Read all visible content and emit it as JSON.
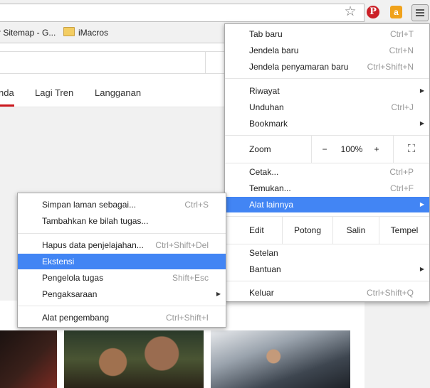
{
  "bookmarks_bar": {
    "items": [
      "r Sitemap - G...",
      "iMacros"
    ]
  },
  "youtube_tabs": [
    "nda",
    "Lagi Tren",
    "Langganan"
  ],
  "chrome_menu": {
    "tab_baru": {
      "label": "Tab baru",
      "shortcut": "Ctrl+T"
    },
    "jendela_baru": {
      "label": "Jendela baru",
      "shortcut": "Ctrl+N"
    },
    "jendela_penyamaran": {
      "label": "Jendela penyamaran baru",
      "shortcut": "Ctrl+Shift+N"
    },
    "riwayat": {
      "label": "Riwayat"
    },
    "unduhan": {
      "label": "Unduhan",
      "shortcut": "Ctrl+J"
    },
    "bookmark": {
      "label": "Bookmark"
    },
    "zoom": {
      "label": "Zoom",
      "minus": "−",
      "value": "100%",
      "plus": "+"
    },
    "cetak": {
      "label": "Cetak...",
      "shortcut": "Ctrl+P"
    },
    "temukan": {
      "label": "Temukan...",
      "shortcut": "Ctrl+F"
    },
    "alat_lainnya": {
      "label": "Alat lainnya"
    },
    "edit": {
      "label": "Edit",
      "potong": "Potong",
      "salin": "Salin",
      "tempel": "Tempel"
    },
    "setelan": {
      "label": "Setelan"
    },
    "bantuan": {
      "label": "Bantuan"
    },
    "keluar": {
      "label": "Keluar",
      "shortcut": "Ctrl+Shift+Q"
    }
  },
  "submenu": {
    "simpan": {
      "label": "Simpan laman sebagai...",
      "shortcut": "Ctrl+S"
    },
    "tambahkan": {
      "label": "Tambahkan ke bilah tugas..."
    },
    "hapus": {
      "label": "Hapus data penjelajahan...",
      "shortcut": "Ctrl+Shift+Del"
    },
    "ekstensi": {
      "label": "Ekstensi"
    },
    "pengelola": {
      "label": "Pengelola tugas",
      "shortcut": "Shift+Esc"
    },
    "pengaksaraan": {
      "label": "Pengaksaraan"
    },
    "alat_pengembang": {
      "label": "Alat pengembang",
      "shortcut": "Ctrl+Shift+I"
    }
  },
  "icons": {
    "pinterest_glyph": "P",
    "amazon_glyph": "a",
    "star_glyph": "☆",
    "arrow_glyph": "▶",
    "fullscreen_glyph": "⛶"
  },
  "colors": {
    "highlight": "#4285f4",
    "youtube_red": "#cc181e",
    "pinterest_red": "#cb2027",
    "amazon_orange": "#f0a21b"
  }
}
